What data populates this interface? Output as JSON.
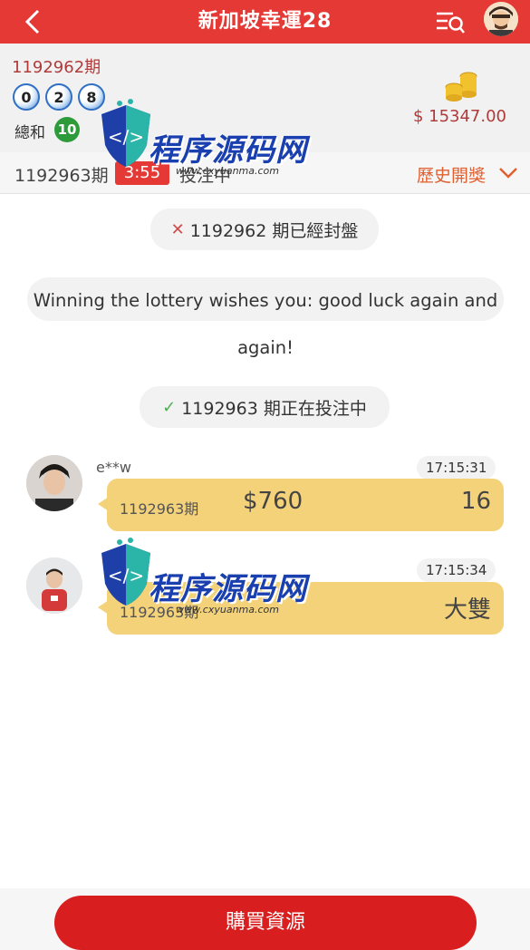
{
  "header": {
    "title": "新加坡幸運28",
    "back_icon": "chevron-left-icon",
    "list_search_icon": "list-search-icon"
  },
  "result": {
    "prev_period": "1192962期",
    "balls": [
      "0",
      "2",
      "8"
    ],
    "sum_label": "總和",
    "sum_value": "10",
    "balance": "$ 15347.00"
  },
  "period_bar": {
    "current_period": "1192963期",
    "countdown": "3:55",
    "status": "投注中",
    "history_label": "歷史開獎"
  },
  "chat": {
    "closed_notice": "1192962 期已經封盤",
    "wish_text": "Winning the lottery wishes you: good luck again and again!",
    "open_notice": "1192963 期正在投注中",
    "messages": [
      {
        "name": "e**w",
        "time": "17:15:31",
        "period": "1192963期",
        "amount": "$760",
        "pick": "16"
      },
      {
        "name": "",
        "time": "17:15:34",
        "period": "1192963期",
        "amount": "",
        "pick": "大雙"
      }
    ]
  },
  "watermark": {
    "text": "程序源码网",
    "url": "www.cxyuanma.com"
  },
  "footer": {
    "buy_label": "購買資源"
  },
  "colors": {
    "primary": "#e53935",
    "bubble": "#f3d27a",
    "ball": "#2f6fc4",
    "sum_badge": "#2e9b3b"
  }
}
